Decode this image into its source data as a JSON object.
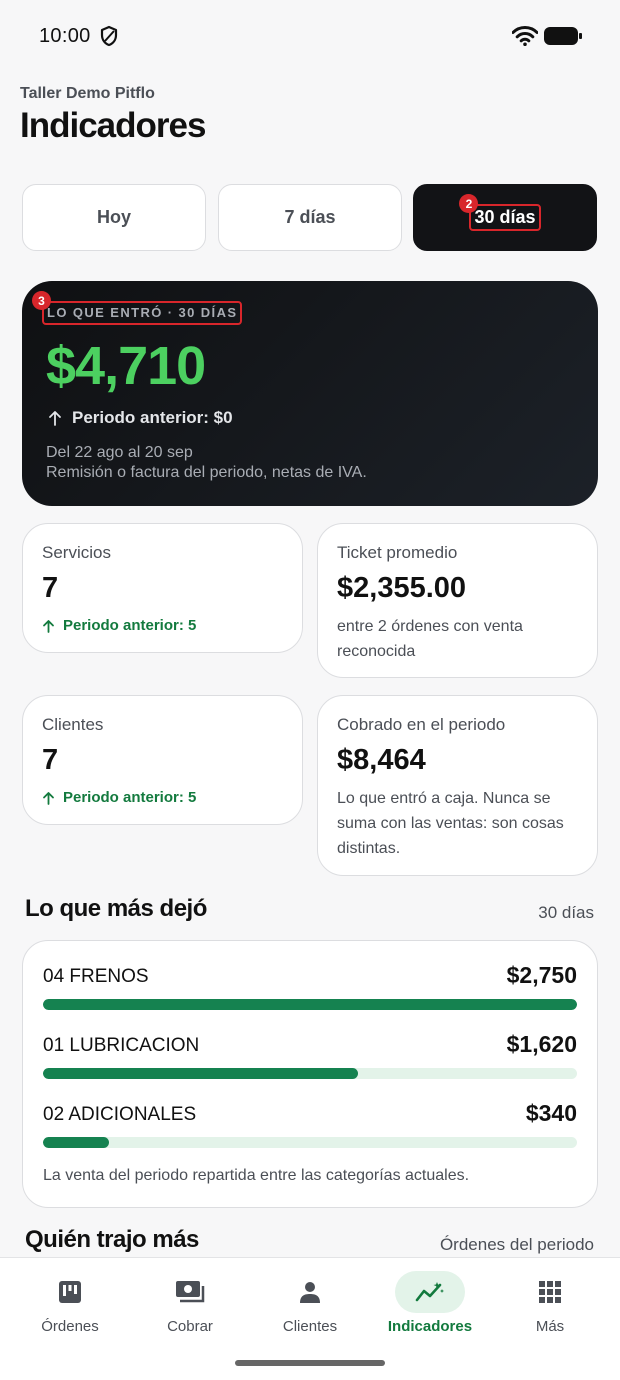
{
  "status_bar": {
    "time": "10:00"
  },
  "header": {
    "workshop": "Taller Demo Pitflo",
    "title": "Indicadores"
  },
  "period_tabs": [
    {
      "label": "Hoy"
    },
    {
      "label": "7 días"
    },
    {
      "label": "30 días",
      "selected": true,
      "marker": "2"
    }
  ],
  "revenue": {
    "marker": "3",
    "label": "LO QUE ENTRÓ · 30 DÍAS",
    "amount": "$4,710",
    "previous": "Periodo anterior: $0",
    "range": "Del 22 ago al 20 sep",
    "note": "Remisión o factura del periodo, netas de IVA."
  },
  "metrics": {
    "services": {
      "title": "Servicios",
      "value": "7",
      "trend": "Periodo anterior: 5"
    },
    "avg_ticket": {
      "title": "Ticket promedio",
      "value": "$2,355.00",
      "desc": "entre 2 órdenes con venta reconocida"
    },
    "clients": {
      "title": "Clientes",
      "value": "7",
      "trend": "Periodo anterior: 5"
    },
    "collected": {
      "title": "Cobrado en el periodo",
      "value": "$8,464",
      "desc": "Lo que entró a caja. Nunca se suma con las ventas: son cosas distintas."
    }
  },
  "top_categories": {
    "title": "Lo que más dejó",
    "period": "30 días",
    "items": [
      {
        "name": "04 FRENOS",
        "amount": "$2,750",
        "share": 1.0
      },
      {
        "name": "01 LUBRICACION",
        "amount": "$1,620",
        "share": 0.589
      },
      {
        "name": "02 ADICIONALES",
        "amount": "$340",
        "share": 0.124
      }
    ],
    "footnote": "La venta del periodo repartida entre las categorías actuales."
  },
  "top_clients": {
    "title": "Quién trajo más",
    "subtitle": "Órdenes del periodo"
  },
  "accent_color": "#137a3e",
  "nav": [
    {
      "label": "Órdenes",
      "icon": "kanban-board-icon"
    },
    {
      "label": "Cobrar",
      "icon": "cash-icon"
    },
    {
      "label": "Clientes",
      "icon": "person-icon"
    },
    {
      "label": "Indicadores",
      "icon": "trend-chart-icon",
      "active": true
    },
    {
      "label": "Más",
      "icon": "grid-icon"
    }
  ]
}
